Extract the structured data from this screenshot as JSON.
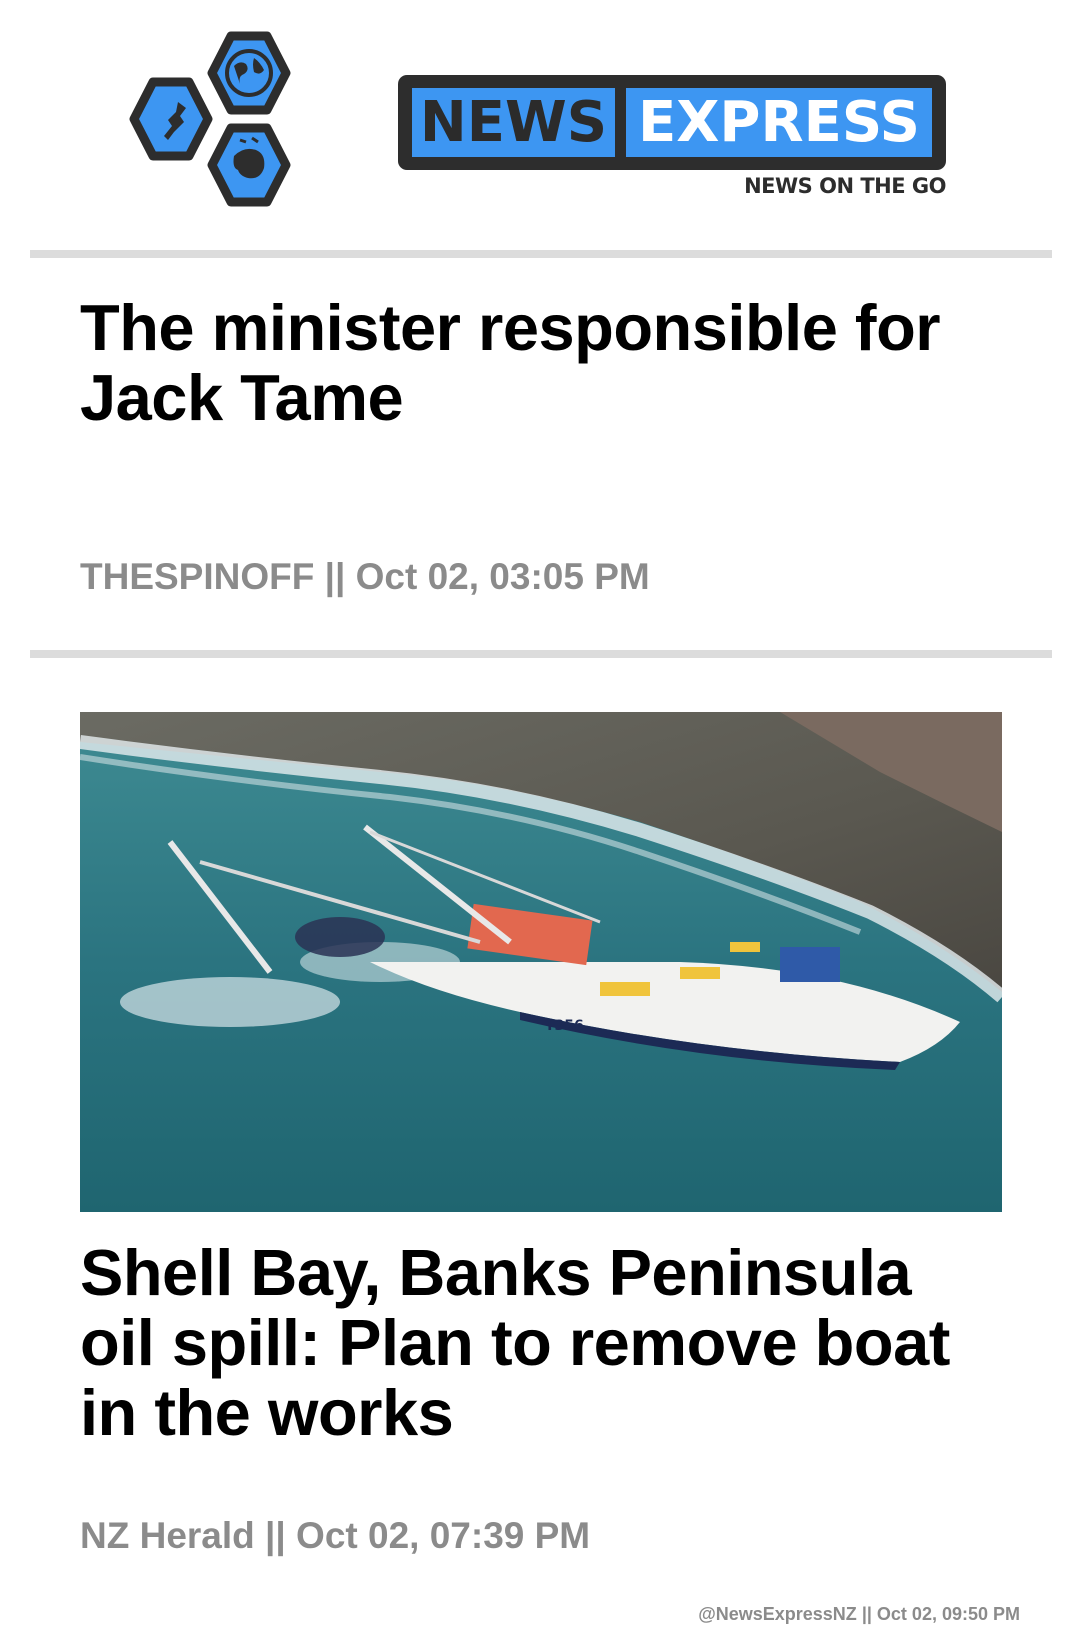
{
  "header": {
    "brand_left": "NEWS",
    "brand_right": "EXPRESS",
    "tagline": "NEWS ON THE GO",
    "colors": {
      "accent": "#3d96f2",
      "dark": "#2d2d2d"
    }
  },
  "articles": [
    {
      "title": "The minister responsible for Jack Tame",
      "source": "THESPINOFF",
      "separator": "||",
      "timestamp": "Oct 02, 03:05 PM"
    },
    {
      "title": "Shell Bay, Banks Peninsula oil spill: Plan to remove boat in the works",
      "source": "NZ Herald",
      "separator": "||",
      "timestamp": "Oct 02, 07:39 PM",
      "image": {
        "description_icon": "boat-photo",
        "hull_number": "T356"
      }
    }
  ],
  "footer": {
    "handle": "@NewsExpressNZ",
    "separator": "||",
    "timestamp": "Oct 02, 09:50 PM"
  }
}
